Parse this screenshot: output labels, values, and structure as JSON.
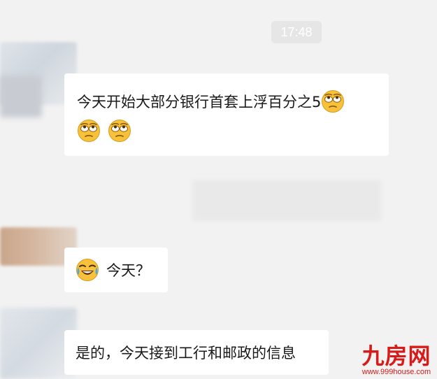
{
  "chat": {
    "timestamp": "17:48",
    "messages": [
      {
        "text": "今天开始大部分银行首套上浮百分之5",
        "trailing_emojis": [
          "eye-roll-emoji",
          "eye-roll-emoji",
          "eye-roll-emoji"
        ]
      },
      {
        "leading_emoji": "laugh-cry-emoji",
        "text": "今天？"
      },
      {
        "text": "是的，今天接到工行和邮政的信息"
      }
    ]
  },
  "watermark": {
    "logo": "九房网",
    "url": "www.999house.com"
  },
  "colors": {
    "background": "#f2f2f2",
    "bubble": "#ffffff",
    "watermark": "#d61b1b",
    "timestamp_bg": "#e6e6e6"
  }
}
